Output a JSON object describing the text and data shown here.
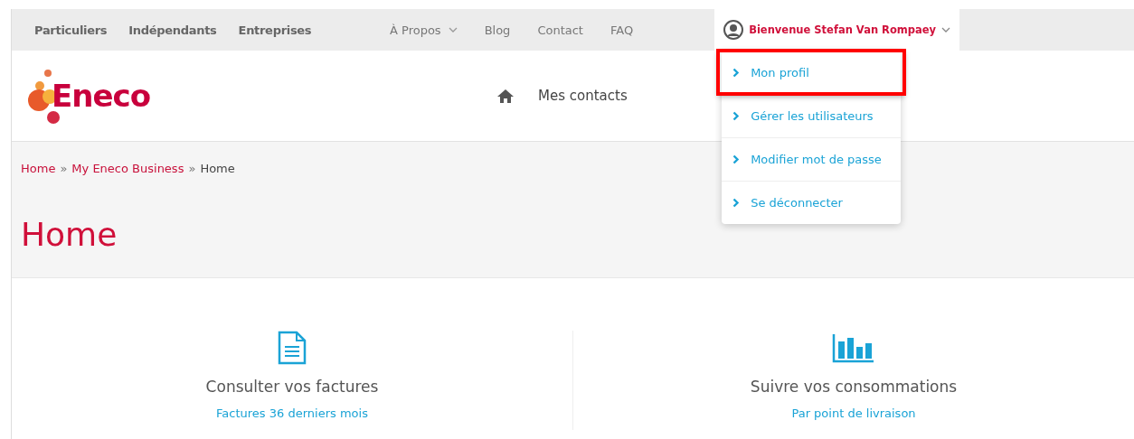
{
  "top_nav": {
    "left_links": [
      "Particuliers",
      "Indépendants",
      "Entreprises"
    ],
    "center_links": [
      {
        "label": "À Propos",
        "dropdown": true
      },
      {
        "label": "Blog",
        "dropdown": false
      },
      {
        "label": "Contact",
        "dropdown": false
      },
      {
        "label": "FAQ",
        "dropdown": false
      }
    ],
    "user_menu": {
      "label": "Bienvenue Stefan Van Rompaey",
      "expanded": true,
      "items": [
        {
          "label": "Mon profil",
          "highlighted": true
        },
        {
          "label": "Gérer les utilisateurs",
          "highlighted": false
        },
        {
          "label": "Modifier mot de passe",
          "highlighted": false
        },
        {
          "label": "Se déconnecter",
          "highlighted": false
        }
      ]
    }
  },
  "header": {
    "logo": "Eneco",
    "nav_label": "Mes contacts"
  },
  "breadcrumb": [
    {
      "label": "Home",
      "link": true
    },
    {
      "separator": "»",
      "label": "My Eneco Business",
      "link": true
    },
    {
      "separator": "»",
      "label": "Home",
      "link": false
    }
  ],
  "page_title": "Home",
  "cards": [
    {
      "kind": "document",
      "title": "Consulter vos factures",
      "link": "Factures 36 derniers mois"
    },
    {
      "kind": "chart",
      "title": "Suivre vos consommations",
      "link": "Par point de livraison"
    }
  ]
}
